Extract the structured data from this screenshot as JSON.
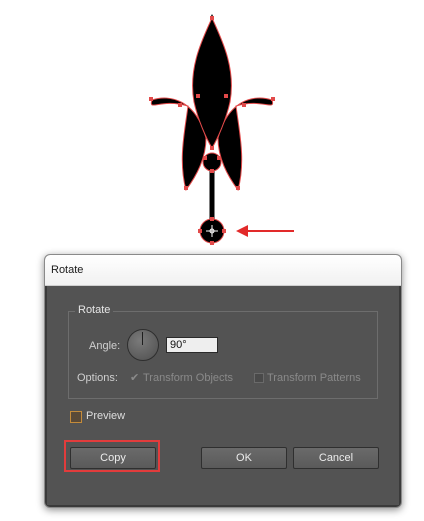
{
  "dialog": {
    "title": "Rotate",
    "group_legend": "Rotate",
    "angle": {
      "label": "Angle:",
      "value": "90°"
    },
    "options": {
      "label": "Options:",
      "transform_objects": {
        "label": "Transform Objects",
        "checked": true
      },
      "transform_patterns": {
        "label": "Transform Patterns",
        "checked": false
      }
    },
    "preview": {
      "label": "Preview",
      "checked": false
    },
    "buttons": {
      "copy": "Copy",
      "ok": "OK",
      "cancel": "Cancel"
    }
  },
  "colors": {
    "highlight": "#e23c3c",
    "anchor_points": "#e24a4a",
    "arrow": "#e22a2a",
    "artwork_fill": "#000000",
    "dialog_body": "#535353"
  },
  "icons": [
    "angle-dial-icon",
    "checkmark-icon",
    "red-arrow-icon",
    "rotate-reference-point-icon"
  ]
}
